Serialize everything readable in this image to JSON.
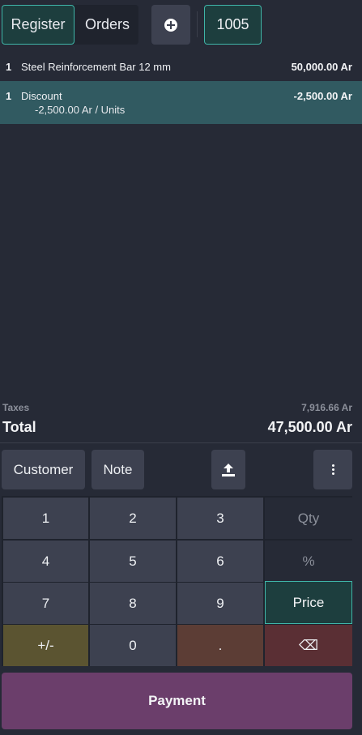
{
  "header": {
    "tabs": [
      {
        "label": "Register",
        "active": true
      },
      {
        "label": "Orders",
        "active": false
      }
    ],
    "new_order_icon": "plus-circle-icon",
    "current_order": "1005"
  },
  "order_lines": [
    {
      "qty": "1",
      "name": "Steel Reinforcement Bar 12 mm",
      "price": "50,000.00 Ar",
      "selected": false
    },
    {
      "qty": "1",
      "name": "Discount",
      "detail": "-2,500.00 Ar / Units",
      "price": "-2,500.00 Ar",
      "selected": true
    }
  ],
  "totals": {
    "taxes_label": "Taxes",
    "taxes_value": "7,916.66 Ar",
    "total_label": "Total",
    "total_value": "47,500.00 Ar"
  },
  "controls": {
    "customer": "Customer",
    "note": "Note",
    "upload_icon": "upload-icon",
    "more_icon": "more-vertical-icon"
  },
  "numpad": {
    "keys": [
      "1",
      "2",
      "3",
      "Qty",
      "4",
      "5",
      "6",
      "%",
      "7",
      "8",
      "9",
      "Price",
      "+/-",
      "0",
      ".",
      "⌫"
    ],
    "active_mode": "Price"
  },
  "payment_label": "Payment",
  "colors": {
    "background": "#262a36",
    "accent": "#3fb5a8",
    "selected_line": "#315a61",
    "payment": "#6b3e6b",
    "sign_key": "#5b5431",
    "dot_key": "#5c3d35",
    "backspace_key": "#5a2f34"
  }
}
